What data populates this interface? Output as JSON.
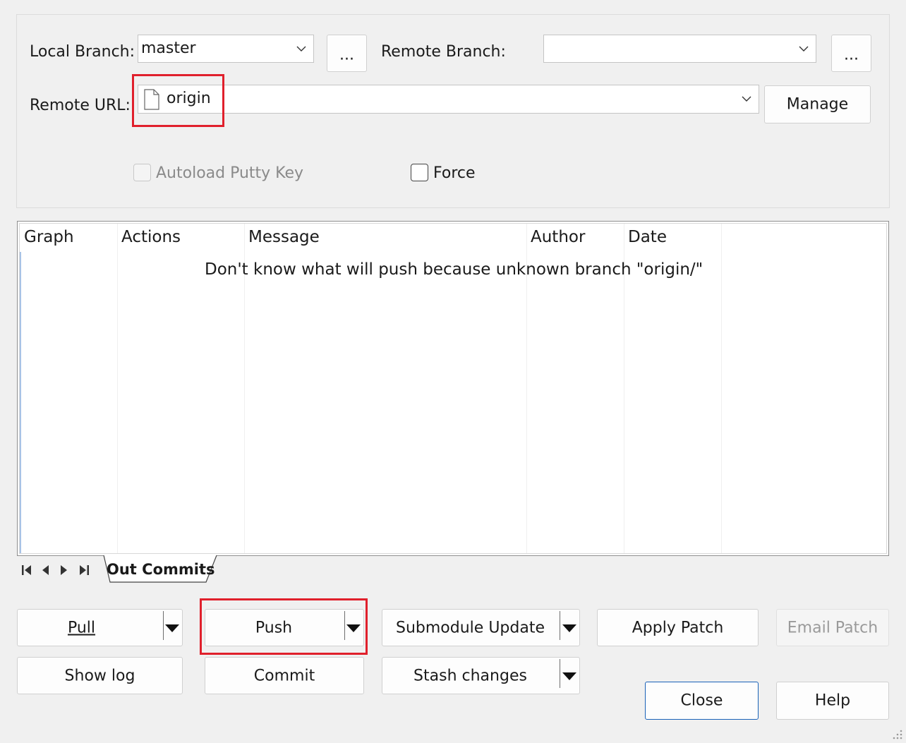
{
  "top_panel": {
    "local_branch_label": "Local Branch:",
    "local_branch_value": "master",
    "local_browse_label": "...",
    "remote_branch_label": "Remote Branch:",
    "remote_branch_value": "",
    "remote_browse_label": "...",
    "remote_url_label": "Remote URL:",
    "remote_url_value": "origin",
    "manage_label": "Manage",
    "autoload_label": "Autoload Putty Key",
    "force_label": "Force"
  },
  "grid": {
    "columns": [
      "Graph",
      "Actions",
      "Message",
      "Author",
      "Date"
    ],
    "empty_message": "Don't know what will push because unknown branch \"origin/\""
  },
  "tabs": {
    "active_label": "Out Commits"
  },
  "actions": {
    "pull_label": "Pull",
    "push_label": "Push",
    "submodule_update_label": "Submodule Update",
    "apply_patch_label": "Apply Patch",
    "email_patch_label": "Email Patch",
    "show_log_label": "Show log",
    "commit_label": "Commit",
    "stash_label": "Stash changes",
    "close_label": "Close",
    "help_label": "Help"
  },
  "colors": {
    "highlight": "#e0202c",
    "focus_border": "#1a62b8"
  }
}
